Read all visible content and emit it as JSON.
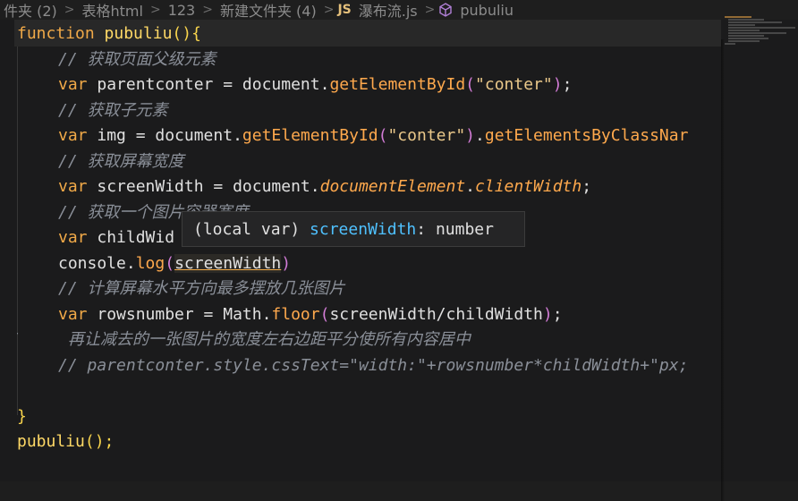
{
  "breadcrumb": {
    "items": [
      "件夹 (2)",
      "表格html",
      "123",
      "新建文件夹 (4)",
      "瀑布流.js",
      "pubuliu"
    ],
    "js_badge": "JS"
  },
  "code": {
    "l1": {
      "kw": "function",
      "name": "pubuliu",
      "rest": "(){"
    },
    "l2": {
      "comment": "// 获取页面父级元素"
    },
    "l3": {
      "kw": "var",
      "var": " parentconter = document.",
      "method": "getElementById",
      "open": "(",
      "str": "\"conter\"",
      "close": ")",
      "end": ";"
    },
    "l4": {
      "comment": "// 获取子元素"
    },
    "l5": {
      "kw": "var",
      "var": " img = document.",
      "method": "getElementById",
      "open": "(",
      "str": "\"conter\"",
      "close": ")",
      "dot": ".",
      "method2": "getElementsByClassNar"
    },
    "l6": {
      "comment": "// 获取屏幕宽度"
    },
    "l7": {
      "kw": "var",
      "var": " screenWidth = document.",
      "prop1": "documentElement",
      "dot": ".",
      "prop2": "clientWidth",
      "end": ";"
    },
    "l8": {
      "comment": "// 获取一个图片容器宽度"
    },
    "l9": {
      "kw": "var",
      "var": " childWid"
    },
    "l10": {
      "obj": "console.",
      "method": "log",
      "open": "(",
      "arg": "screenWidth",
      "close": ")"
    },
    "l11": {
      "comment": "// 计算屏幕水平方向最多摆放几张图片"
    },
    "l12": {
      "kw": "var",
      "var": " rowsnumber = Math.",
      "method": "floor",
      "open": "(",
      "arg": "screenWidth/childWidth",
      "close": ")",
      "end": ";"
    },
    "l13": {
      "comment": "//     再让减去的一张图片的宽度左右边距平分使所有内容居中"
    },
    "l14": {
      "comment": "// parentconter.style.cssText=\"width:\"+rowsnumber*childWidth+\"px;"
    },
    "l16": {
      "brace": "}"
    },
    "l17": {
      "call": "pubuliu",
      "rest": "();"
    }
  },
  "tooltip": {
    "prefix": "(local var) ",
    "name": "screenWidth",
    "suffix": ": number"
  }
}
